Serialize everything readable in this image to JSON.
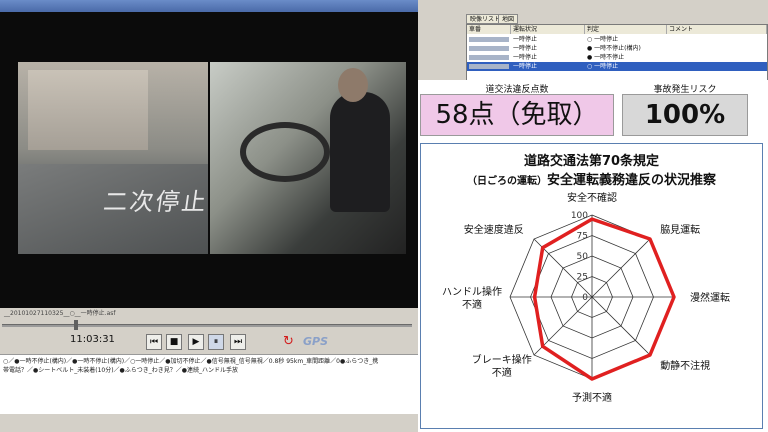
{
  "player": {
    "road_marking": "二次停止",
    "file_name": "__20101027110325__○__一時停止.asf",
    "time": "11:03:31",
    "controls": [
      "first",
      "stop",
      "play",
      "pause",
      "last"
    ],
    "control_glyphs": {
      "first": "⏮",
      "stop": "■",
      "play": "▶",
      "pause": "⏸",
      "last": "⏭"
    },
    "gps_label": "GPS",
    "gps_icon_glyph": "↻",
    "log_lines": [
      "○／●一時不停止(構内)／●一時不停止(構内)／○一時停止／●加切不停止／●信号無視_信号無視／0.8秒 95km_車間距離／0●ふらつき_携",
      "帯電話？／●シートベルト_未装着(10分)／●ふらつき_わき見？／●連続_ハンドル手放"
    ]
  },
  "list_panel": {
    "tabs": [
      "映像リスト",
      "地図"
    ],
    "columns": [
      "車番",
      "運転状況",
      "判定",
      "コメント"
    ],
    "rows": [
      {
        "status": "一時停止",
        "judgement": "○ 一時停止",
        "selected": false
      },
      {
        "status": "一時停止",
        "judgement": "● 一時不停止(構内)",
        "selected": false
      },
      {
        "status": "一時停止",
        "judgement": "● 一時不停止",
        "selected": false
      },
      {
        "status": "一時停止",
        "judgement": "○ 一時停止",
        "selected": true
      }
    ]
  },
  "overlay": {
    "score_caption": "道交法違反点数",
    "score_value": "58点（免取）",
    "risk_caption": "事故発生リスク",
    "risk_value": "100%",
    "chart_title_line1": "道路交通法第70条規定",
    "chart_title_line2_prefix": "（日ごろの運転）",
    "chart_title_line2_main": "安全運転義務違反の状況推察"
  },
  "colors": {
    "score_bg": "#f0c8e8",
    "risk_bg": "#d8d8d8",
    "radar_line": "#e02020",
    "chart_border": "#5a7fb0"
  },
  "chart_data": {
    "type": "radar",
    "categories": [
      "安全不確認",
      "脇見運転",
      "漫然運転",
      "動静不注視",
      "予測不適",
      "ブレーキ操作\n不適",
      "ハンドル操作\n不適",
      "安全速度違反"
    ],
    "ticks": [
      0,
      25,
      50,
      75,
      100
    ],
    "range": [
      0,
      100
    ],
    "values": [
      95,
      100,
      100,
      100,
      100,
      85,
      70,
      85
    ]
  }
}
